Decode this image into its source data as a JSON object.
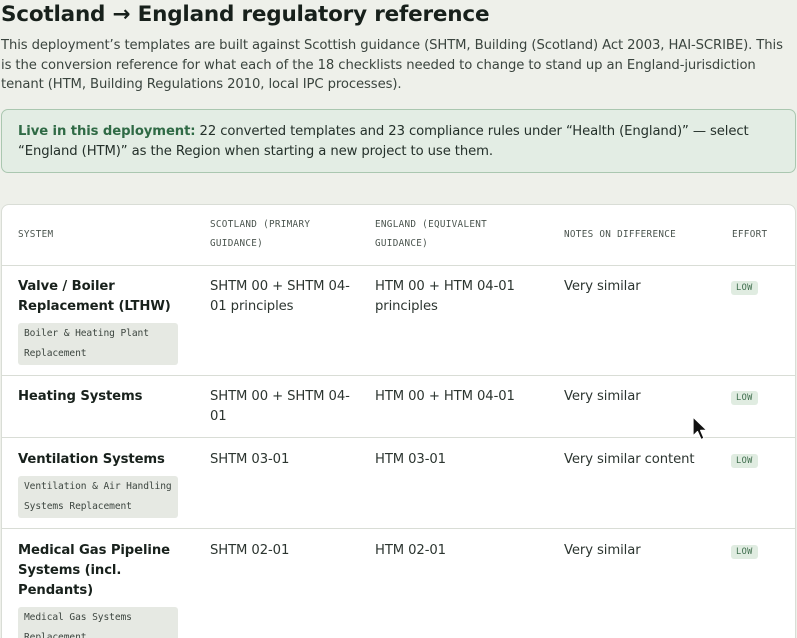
{
  "page": {
    "title": "Scotland → England regulatory reference",
    "intro": "This deployment’s templates are built against Scottish guidance (SHTM, Building (Scotland) Act 2003, HAI-SCRIBE). This is the conversion reference for what each of the 18 checklists needed to change to stand up an England-jurisdiction tenant (HTM, Building Regulations 2010, local IPC processes)."
  },
  "callout": {
    "lead": "Live in this deployment:",
    "text": " 22 converted templates and 23 compliance rules under “Health (England)” — select “England (HTM)” as the Region when starting a new project to use them."
  },
  "table": {
    "headers": {
      "system": "SYSTEM",
      "scotland": "SCOTLAND (PRIMARY GUIDANCE)",
      "england": "ENGLAND (EQUIVALENT GUIDANCE)",
      "notes": "NOTES ON DIFFERENCE",
      "effort": "EFFORT"
    },
    "rows": [
      {
        "system": "Valve / Boiler Replacement (LTHW)",
        "tag": "Boiler & Heating Plant Replacement",
        "scotland": "SHTM 00 + SHTM 04-01 principles",
        "england": "HTM 00 + HTM 04-01 principles",
        "notes": "Very similar",
        "effort": "LOW"
      },
      {
        "system": "Heating Systems",
        "tag": "",
        "scotland": "SHTM 00 + SHTM 04-01",
        "england": "HTM 00 + HTM 04-01",
        "notes": "Very similar",
        "effort": "LOW"
      },
      {
        "system": "Ventilation Systems",
        "tag": "Ventilation & Air Handling Systems Replacement",
        "scotland": "SHTM 03-01",
        "england": "HTM 03-01",
        "notes": "Very similar content",
        "effort": "LOW"
      },
      {
        "system": "Medical Gas Pipeline Systems (incl. Pendants)",
        "tag": "Medical Gas Systems Replacement",
        "scotland": "SHTM 02-01",
        "england": "HTM 02-01",
        "notes": "Very similar",
        "effort": "LOW"
      }
    ]
  },
  "icons": {
    "cursor": "mouse-pointer-icon"
  },
  "colors": {
    "accent_green": "#2f6a45",
    "callout_bg": "#e3ede4",
    "badge_bg": "#e0ece1",
    "page_bg": "#eef0ea"
  }
}
